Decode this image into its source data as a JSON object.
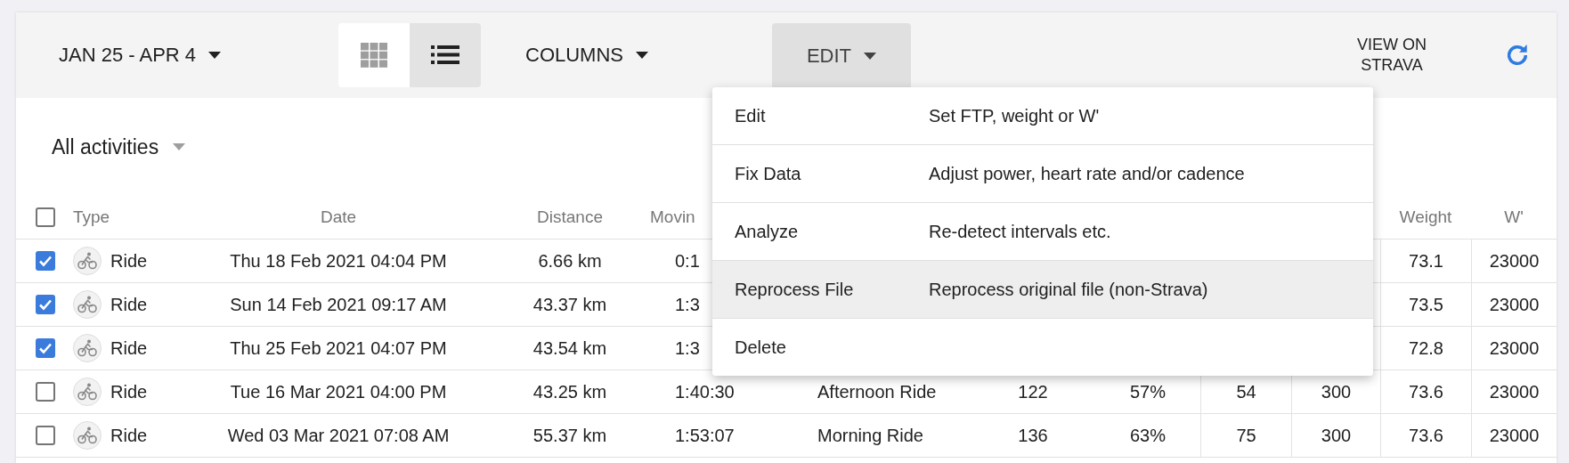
{
  "toolbar": {
    "date_range": "JAN 25 - APR 4",
    "view_toggle": [
      {
        "kind": "grid",
        "selected": false
      },
      {
        "kind": "list",
        "selected": true
      }
    ],
    "columns_button": "COLUMNS",
    "edit_button": {
      "label": "EDIT",
      "expanded": true
    },
    "strava_link": "VIEW ON STRAVA"
  },
  "filter": "All activities",
  "table": {
    "select_all_checked": false,
    "columns": {
      "type": "Type",
      "date": "Date",
      "distance": "Distance",
      "moving": "Movin",
      "weight": "Weight",
      "w_prime": "W'"
    },
    "rows": [
      {
        "checked": true,
        "type": "Ride",
        "date": "Thu 18 Feb 2021 04:04 PM",
        "distance": "6.66 km",
        "moving": "0:1",
        "weight": "73.1",
        "w_prime": "23000"
      },
      {
        "checked": true,
        "type": "Ride",
        "date": "Sun 14 Feb 2021 09:17 AM",
        "distance": "43.37 km",
        "moving": "1:3",
        "weight": "73.5",
        "w_prime": "23000"
      },
      {
        "checked": true,
        "type": "Ride",
        "date": "Thu 25 Feb 2021 04:07 PM",
        "distance": "43.54 km",
        "moving": "1:3",
        "weight": "72.8",
        "w_prime": "23000"
      },
      {
        "checked": false,
        "type": "Ride",
        "date": "Tue 16 Mar 2021 04:00 PM",
        "distance": "43.25 km",
        "moving": "1:40:30",
        "name": "Afternoon Ride",
        "column_7": "122",
        "column_8": "57%",
        "column_9": "54",
        "column_10": "300",
        "weight": "73.6",
        "w_prime": "23000"
      },
      {
        "checked": false,
        "type": "Ride",
        "date": "Wed 03 Mar 2021 07:08 AM",
        "distance": "55.37 km",
        "moving": "1:53:07",
        "name": "Morning Ride",
        "column_7": "136",
        "column_8": "63%",
        "column_9": "75",
        "column_10": "300",
        "weight": "73.6",
        "w_prime": "23000"
      }
    ]
  },
  "edit_menu": [
    {
      "label": "Edit",
      "description": "Set FTP, weight or W'",
      "highlighted": false
    },
    {
      "label": "Fix Data",
      "description": "Adjust power, heart rate and/or cadence",
      "highlighted": false
    },
    {
      "label": "Analyze",
      "description": "Re-detect intervals etc.",
      "highlighted": false
    },
    {
      "label": "Reprocess File",
      "description": "Reprocess original file (non-Strava)",
      "highlighted": true
    },
    {
      "label": "Delete",
      "highlighted": false
    }
  ]
}
